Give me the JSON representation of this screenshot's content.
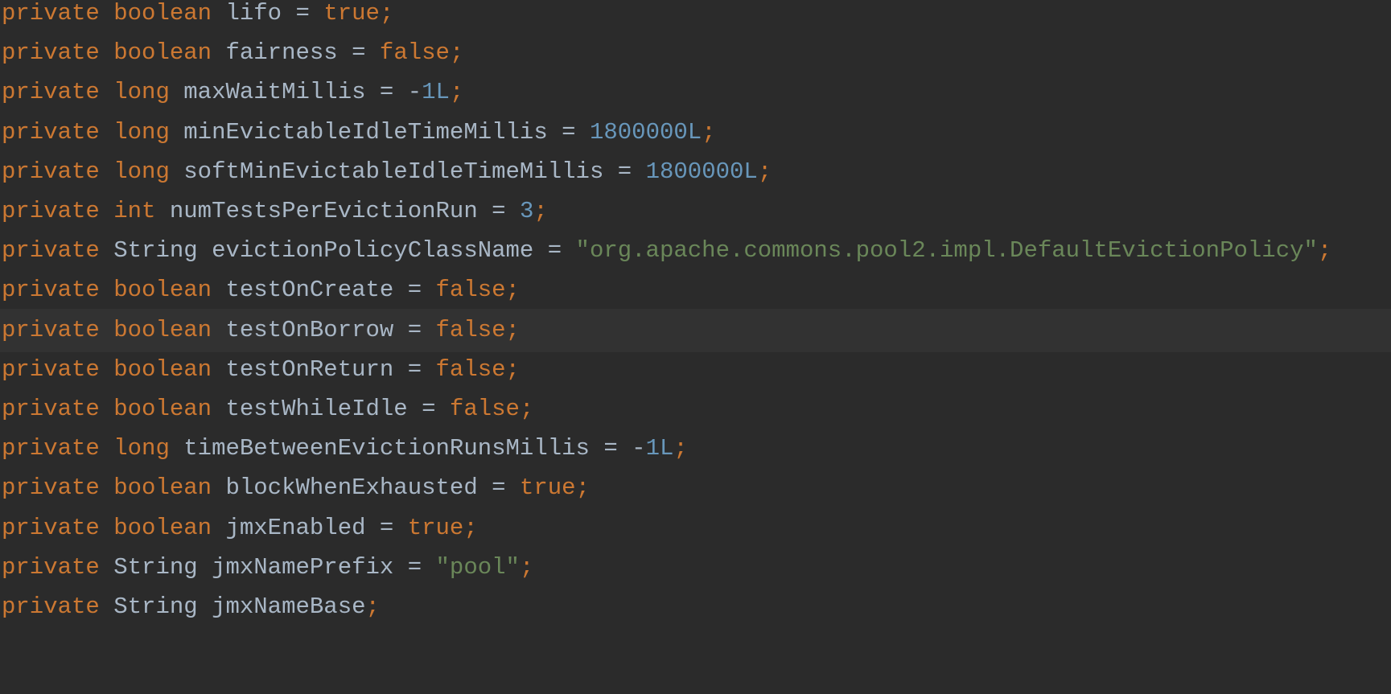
{
  "editor": {
    "current_line_index": 8,
    "colors": {
      "background": "#2b2b2b",
      "current_line": "#323232",
      "keyword": "#cc7832",
      "identifier": "#a9b7c6",
      "number": "#6897bb",
      "string": "#6a8759"
    },
    "lines": [
      [
        {
          "k": "kw",
          "t": "private"
        },
        {
          "k": "op",
          "t": " "
        },
        {
          "k": "kw",
          "t": "boolean"
        },
        {
          "k": "op",
          "t": " "
        },
        {
          "k": "id",
          "t": "lifo"
        },
        {
          "k": "op",
          "t": " = "
        },
        {
          "k": "kw",
          "t": "true"
        },
        {
          "k": "semi",
          "t": ";"
        }
      ],
      [
        {
          "k": "kw",
          "t": "private"
        },
        {
          "k": "op",
          "t": " "
        },
        {
          "k": "kw",
          "t": "boolean"
        },
        {
          "k": "op",
          "t": " "
        },
        {
          "k": "id",
          "t": "fairness"
        },
        {
          "k": "op",
          "t": " = "
        },
        {
          "k": "kw",
          "t": "false"
        },
        {
          "k": "semi",
          "t": ";"
        }
      ],
      [
        {
          "k": "kw",
          "t": "private"
        },
        {
          "k": "op",
          "t": " "
        },
        {
          "k": "kw",
          "t": "long"
        },
        {
          "k": "op",
          "t": " "
        },
        {
          "k": "id",
          "t": "maxWaitMillis"
        },
        {
          "k": "op",
          "t": " = -"
        },
        {
          "k": "num",
          "t": "1L"
        },
        {
          "k": "semi",
          "t": ";"
        }
      ],
      [
        {
          "k": "kw",
          "t": "private"
        },
        {
          "k": "op",
          "t": " "
        },
        {
          "k": "kw",
          "t": "long"
        },
        {
          "k": "op",
          "t": " "
        },
        {
          "k": "id",
          "t": "minEvictableIdleTimeMillis"
        },
        {
          "k": "op",
          "t": " = "
        },
        {
          "k": "num",
          "t": "1800000L"
        },
        {
          "k": "semi",
          "t": ";"
        }
      ],
      [
        {
          "k": "kw",
          "t": "private"
        },
        {
          "k": "op",
          "t": " "
        },
        {
          "k": "kw",
          "t": "long"
        },
        {
          "k": "op",
          "t": " "
        },
        {
          "k": "id",
          "t": "softMinEvictableIdleTimeMillis"
        },
        {
          "k": "op",
          "t": " = "
        },
        {
          "k": "num",
          "t": "1800000L"
        },
        {
          "k": "semi",
          "t": ";"
        }
      ],
      [
        {
          "k": "kw",
          "t": "private"
        },
        {
          "k": "op",
          "t": " "
        },
        {
          "k": "kw",
          "t": "int"
        },
        {
          "k": "op",
          "t": " "
        },
        {
          "k": "id",
          "t": "numTestsPerEvictionRun"
        },
        {
          "k": "op",
          "t": " = "
        },
        {
          "k": "num",
          "t": "3"
        },
        {
          "k": "semi",
          "t": ";"
        }
      ],
      [
        {
          "k": "kw",
          "t": "private"
        },
        {
          "k": "op",
          "t": " "
        },
        {
          "k": "type",
          "t": "String"
        },
        {
          "k": "op",
          "t": " "
        },
        {
          "k": "id",
          "t": "evictionPolicyClassName"
        },
        {
          "k": "op",
          "t": " = "
        },
        {
          "k": "str",
          "t": "\"org.apache.commons.pool2.impl.DefaultEvictionPolicy\""
        },
        {
          "k": "semi",
          "t": ";"
        }
      ],
      [
        {
          "k": "kw",
          "t": "private"
        },
        {
          "k": "op",
          "t": " "
        },
        {
          "k": "kw",
          "t": "boolean"
        },
        {
          "k": "op",
          "t": " "
        },
        {
          "k": "id",
          "t": "testOnCreate"
        },
        {
          "k": "op",
          "t": " = "
        },
        {
          "k": "kw",
          "t": "false"
        },
        {
          "k": "semi",
          "t": ";"
        }
      ],
      [
        {
          "k": "kw",
          "t": "private"
        },
        {
          "k": "op",
          "t": " "
        },
        {
          "k": "kw",
          "t": "boolean"
        },
        {
          "k": "op",
          "t": " "
        },
        {
          "k": "id",
          "t": "testOnBorrow"
        },
        {
          "k": "op",
          "t": " = "
        },
        {
          "k": "kw",
          "t": "false"
        },
        {
          "k": "semi",
          "t": ";"
        }
      ],
      [
        {
          "k": "kw",
          "t": "private"
        },
        {
          "k": "op",
          "t": " "
        },
        {
          "k": "kw",
          "t": "boolean"
        },
        {
          "k": "op",
          "t": " "
        },
        {
          "k": "id",
          "t": "testOnReturn"
        },
        {
          "k": "op",
          "t": " = "
        },
        {
          "k": "kw",
          "t": "false"
        },
        {
          "k": "semi",
          "t": ";"
        }
      ],
      [
        {
          "k": "kw",
          "t": "private"
        },
        {
          "k": "op",
          "t": " "
        },
        {
          "k": "kw",
          "t": "boolean"
        },
        {
          "k": "op",
          "t": " "
        },
        {
          "k": "id",
          "t": "testWhileIdle"
        },
        {
          "k": "op",
          "t": " = "
        },
        {
          "k": "kw",
          "t": "false"
        },
        {
          "k": "semi",
          "t": ";"
        }
      ],
      [
        {
          "k": "kw",
          "t": "private"
        },
        {
          "k": "op",
          "t": " "
        },
        {
          "k": "kw",
          "t": "long"
        },
        {
          "k": "op",
          "t": " "
        },
        {
          "k": "id",
          "t": "timeBetweenEvictionRunsMillis"
        },
        {
          "k": "op",
          "t": " = -"
        },
        {
          "k": "num",
          "t": "1L"
        },
        {
          "k": "semi",
          "t": ";"
        }
      ],
      [
        {
          "k": "kw",
          "t": "private"
        },
        {
          "k": "op",
          "t": " "
        },
        {
          "k": "kw",
          "t": "boolean"
        },
        {
          "k": "op",
          "t": " "
        },
        {
          "k": "id",
          "t": "blockWhenExhausted"
        },
        {
          "k": "op",
          "t": " = "
        },
        {
          "k": "kw",
          "t": "true"
        },
        {
          "k": "semi",
          "t": ";"
        }
      ],
      [
        {
          "k": "kw",
          "t": "private"
        },
        {
          "k": "op",
          "t": " "
        },
        {
          "k": "kw",
          "t": "boolean"
        },
        {
          "k": "op",
          "t": " "
        },
        {
          "k": "id",
          "t": "jmxEnabled"
        },
        {
          "k": "op",
          "t": " = "
        },
        {
          "k": "kw",
          "t": "true"
        },
        {
          "k": "semi",
          "t": ";"
        }
      ],
      [
        {
          "k": "kw",
          "t": "private"
        },
        {
          "k": "op",
          "t": " "
        },
        {
          "k": "type",
          "t": "String"
        },
        {
          "k": "op",
          "t": " "
        },
        {
          "k": "id",
          "t": "jmxNamePrefix"
        },
        {
          "k": "op",
          "t": " = "
        },
        {
          "k": "str",
          "t": "\"pool\""
        },
        {
          "k": "semi",
          "t": ";"
        }
      ],
      [
        {
          "k": "kw",
          "t": "private"
        },
        {
          "k": "op",
          "t": " "
        },
        {
          "k": "type",
          "t": "String"
        },
        {
          "k": "op",
          "t": " "
        },
        {
          "k": "id",
          "t": "jmxNameBase"
        },
        {
          "k": "semi",
          "t": ";"
        }
      ]
    ]
  }
}
